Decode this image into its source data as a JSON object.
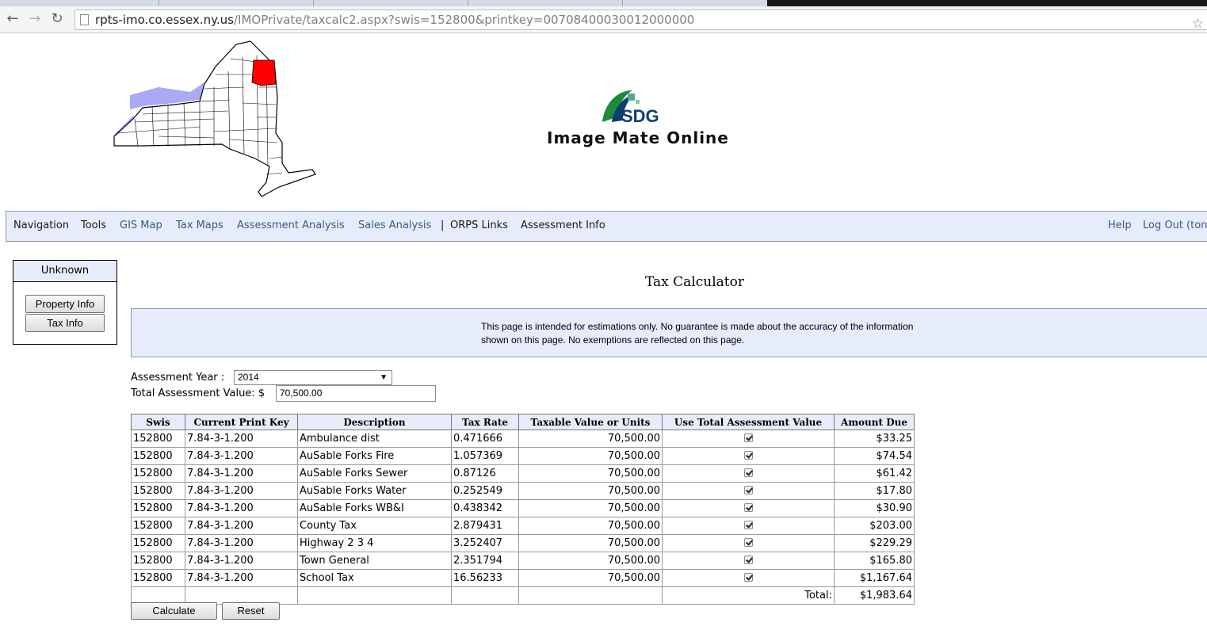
{
  "browser": {
    "url_host": "rpts-imo.co.essex.ny.us",
    "url_path": "/IMOPrivate/taxcalc2.aspx?swis=152800&printkey=00708400030012000000"
  },
  "header": {
    "logo_text": "Image Mate Online",
    "logo_mark": "SDG"
  },
  "menu": {
    "left_items": [
      {
        "label": "Navigation",
        "style": "dark"
      },
      {
        "label": "Tools",
        "style": "dark"
      },
      {
        "label": "GIS Map",
        "style": "link"
      },
      {
        "label": "Tax Maps",
        "style": "link"
      },
      {
        "label": "Assessment Analysis",
        "style": "link"
      },
      {
        "label": "Sales Analysis",
        "style": "link"
      },
      {
        "label": "ORPS Links",
        "style": "dark"
      },
      {
        "label": "Assessment Info",
        "style": "dark"
      }
    ],
    "separator": "|",
    "right_items": [
      {
        "label": "Help",
        "style": "link"
      },
      {
        "label": "Log Out (ton",
        "style": "link"
      }
    ]
  },
  "sidebar": {
    "header": "Unknown",
    "buttons": [
      "Property Info",
      "Tax Info"
    ]
  },
  "page": {
    "title": "Tax Calculator",
    "notice": "This page is intended for estimations only. No guarantee is made about the accuracy of the information shown on this page. No exemptions are reflected on this page."
  },
  "form": {
    "year_label": "Assessment Year :",
    "year_value": "2014",
    "assessment_label": "Total Assessment Value: $",
    "assessment_value": "70,500.00"
  },
  "table": {
    "columns": [
      "Swis",
      "Current Print Key",
      "Description",
      "Tax Rate",
      "Taxable Value or Units",
      "Use Total Assessment Value",
      "Amount Due"
    ],
    "rows": [
      {
        "swis": "152800",
        "print_key": "7.84-3-1.200",
        "description": "Ambulance dist",
        "tax_rate": "0.471666",
        "taxable_value": "70,500.00",
        "use_total": true,
        "amount_due": "$33.25"
      },
      {
        "swis": "152800",
        "print_key": "7.84-3-1.200",
        "description": "AuSable Forks Fire",
        "tax_rate": "1.057369",
        "taxable_value": "70,500.00",
        "use_total": true,
        "amount_due": "$74.54"
      },
      {
        "swis": "152800",
        "print_key": "7.84-3-1.200",
        "description": "AuSable Forks Sewer",
        "tax_rate": "0.87126",
        "taxable_value": "70,500.00",
        "use_total": true,
        "amount_due": "$61.42"
      },
      {
        "swis": "152800",
        "print_key": "7.84-3-1.200",
        "description": "AuSable Forks Water",
        "tax_rate": "0.252549",
        "taxable_value": "70,500.00",
        "use_total": true,
        "amount_due": "$17.80"
      },
      {
        "swis": "152800",
        "print_key": "7.84-3-1.200",
        "description": "AuSable Forks WB&I",
        "tax_rate": "0.438342",
        "taxable_value": "70,500.00",
        "use_total": true,
        "amount_due": "$30.90"
      },
      {
        "swis": "152800",
        "print_key": "7.84-3-1.200",
        "description": "County Tax",
        "tax_rate": "2.879431",
        "taxable_value": "70,500.00",
        "use_total": true,
        "amount_due": "$203.00"
      },
      {
        "swis": "152800",
        "print_key": "7.84-3-1.200",
        "description": "Highway 2 3 4",
        "tax_rate": "3.252407",
        "taxable_value": "70,500.00",
        "use_total": true,
        "amount_due": "$229.29"
      },
      {
        "swis": "152800",
        "print_key": "7.84-3-1.200",
        "description": "Town General",
        "tax_rate": "2.351794",
        "taxable_value": "70,500.00",
        "use_total": true,
        "amount_due": "$165.80"
      },
      {
        "swis": "152800",
        "print_key": "7.84-3-1.200",
        "description": "School Tax",
        "tax_rate": "16.56233",
        "taxable_value": "70,500.00",
        "use_total": true,
        "amount_due": "$1,167.64"
      }
    ],
    "total_label": "Total:",
    "total_value": "$1,983.64"
  },
  "actions": {
    "calculate": "Calculate",
    "reset": "Reset"
  },
  "colors": {
    "header_band": "#e6ecfa",
    "link": "#42587f",
    "highlight_county": "#ff0000",
    "water": "#a9a9f5"
  }
}
